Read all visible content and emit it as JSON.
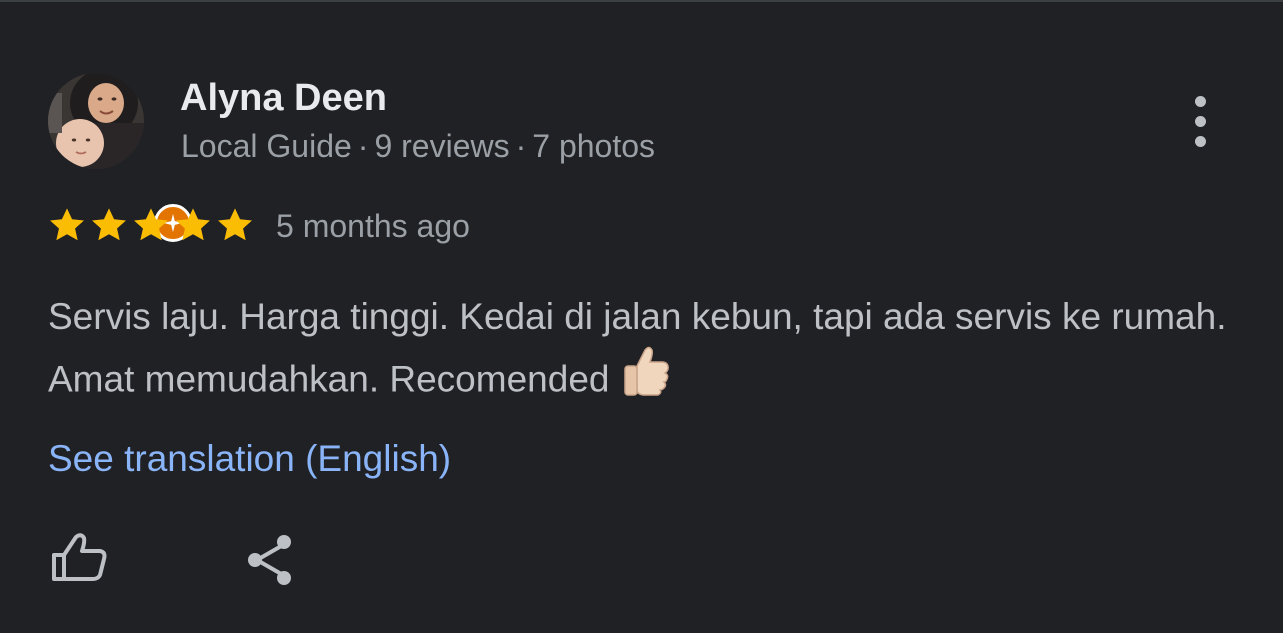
{
  "review": {
    "author": {
      "name": "Alyna Deen",
      "badge_label": "Local Guide",
      "separator": "·",
      "reviews_count": "9 reviews",
      "photos_count": "7 photos",
      "avatar_icon": "user-avatar-photo",
      "badge_icon": "local-guide-star-icon",
      "badge_color": "#e37400"
    },
    "rating": {
      "stars": 5,
      "max_stars": 5,
      "star_color": "#fbbc04"
    },
    "time_ago": "5 months ago",
    "text": "Servis laju. Harga tinggi. Kedai di jalan kebun, tapi ada servis ke rumah. Amat memudahkan. Recomended",
    "emoji": "thumbs-up-emoji",
    "translation_link": "See translation (English)",
    "actions": {
      "like_icon": "thumbs-up-icon",
      "share_icon": "share-icon",
      "more_icon": "more-vert-icon"
    },
    "colors": {
      "background": "#202124",
      "link": "#8ab4f8",
      "secondary_text": "#9aa0a6"
    }
  }
}
